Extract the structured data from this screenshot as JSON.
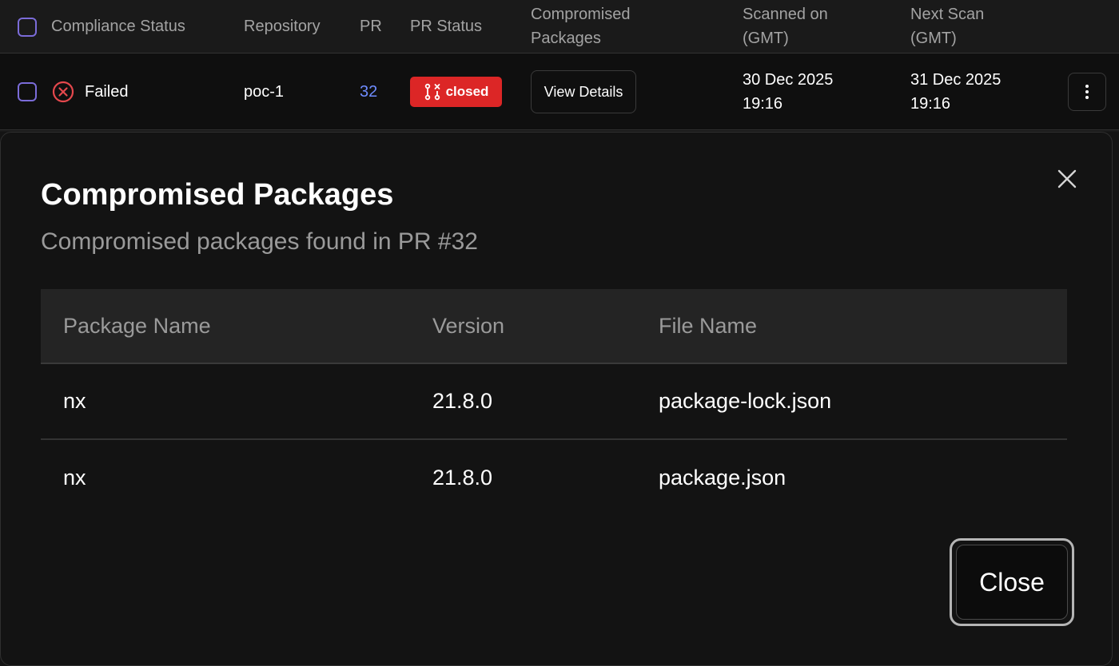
{
  "table": {
    "headers": {
      "compliance_status": "Compliance Status",
      "repository": "Repository",
      "pr": "PR",
      "pr_status": "PR Status",
      "compromised_packages": [
        "Compromised",
        "Packages"
      ],
      "scanned_on": [
        "Scanned on",
        "(GMT)"
      ],
      "next_scan": [
        "Next Scan",
        "(GMT)"
      ]
    },
    "row": {
      "status": "Failed",
      "status_icon": "x-circle-icon",
      "repository": "poc-1",
      "pr": "32",
      "pr_status": "closed",
      "pr_status_icon": "git-pull-request-closed-icon",
      "view_details": "View Details",
      "scanned_on": [
        "30 Dec 2025",
        "19:16"
      ],
      "next_scan": [
        "31 Dec 2025",
        "19:16"
      ],
      "menu_icon": "more-vertical-icon"
    }
  },
  "modal": {
    "title": "Compromised Packages",
    "subtitle": "Compromised packages found in PR #32",
    "close_icon": "close-icon",
    "columns": [
      "Package Name",
      "Version",
      "File Name"
    ],
    "rows": [
      [
        "nx",
        "21.8.0",
        "package-lock.json"
      ],
      [
        "nx",
        "21.8.0",
        "package.json"
      ]
    ],
    "close_label": "Close"
  },
  "colors": {
    "background": "#141414",
    "failed_red": "#e5484d",
    "badge_red": "#dc2626",
    "link_blue": "#6f8cff",
    "checkbox_purple": "#7b6cd9",
    "muted_text": "#9a9a9a"
  }
}
